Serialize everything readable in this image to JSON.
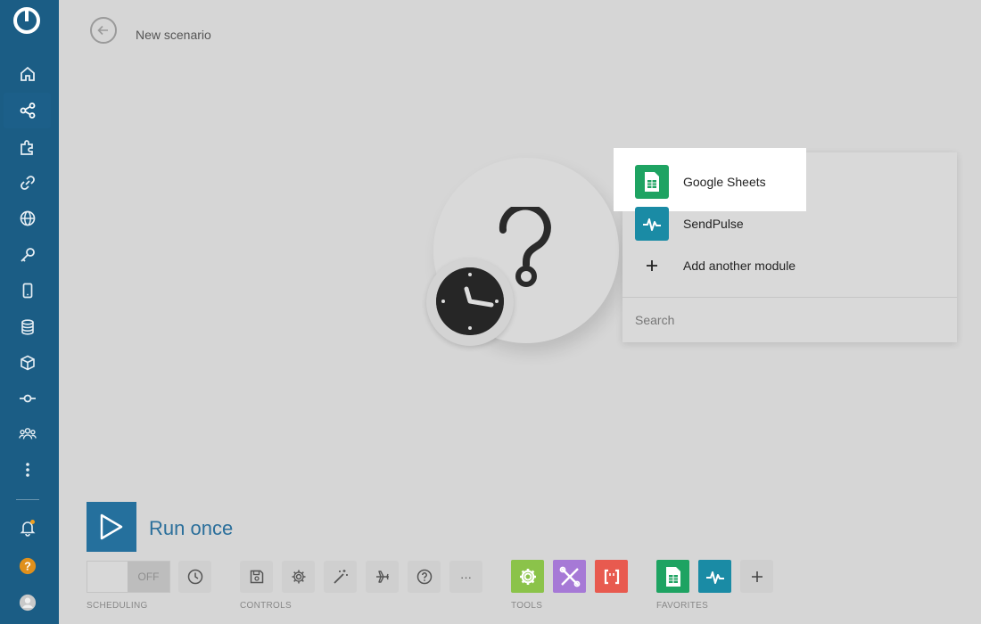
{
  "header": {
    "title": "New scenario"
  },
  "dropdown": {
    "items": [
      {
        "label": "Google Sheets",
        "icon": "google-sheets-icon",
        "color": "#1ea362"
      },
      {
        "label": "SendPulse",
        "icon": "sendpulse-icon",
        "color": "#1a8ba5"
      },
      {
        "label": "Add another module",
        "icon": "plus-icon"
      }
    ],
    "search_placeholder": "Search"
  },
  "toolbar": {
    "run_label": "Run once",
    "scheduling_toggle": "OFF",
    "sections": {
      "scheduling": "SCHEDULING",
      "controls": "CONTROLS",
      "tools": "TOOLS",
      "favorites": "FAVORITES"
    },
    "tools_colors": [
      "#8bc34a",
      "#a679d6",
      "#e85a4f"
    ],
    "favorites_colors": [
      "#1ea362",
      "#1a8ba5"
    ],
    "more_label": "···"
  },
  "colors": {
    "sidebar": "#2272a3",
    "accent": "#2b6f9b"
  }
}
